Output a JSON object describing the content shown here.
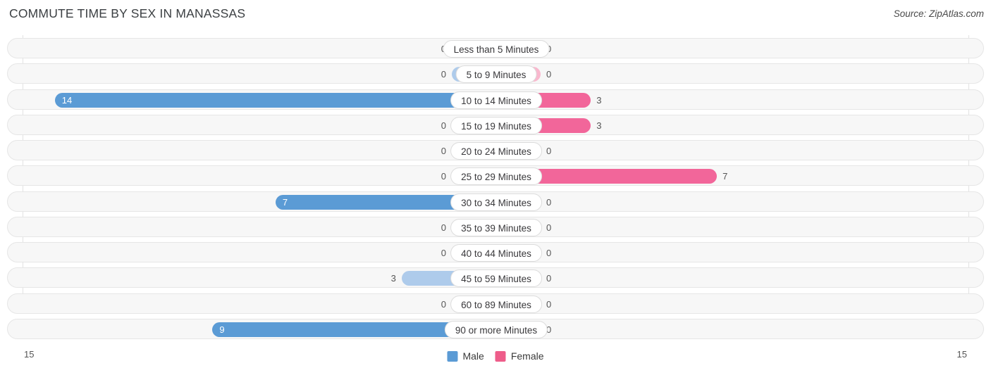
{
  "header": {
    "title": "COMMUTE TIME BY SEX IN MANASSAS",
    "source": "Source: ZipAtlas.com"
  },
  "axis": {
    "left_max_label": "15",
    "right_max_label": "15"
  },
  "legend": {
    "items": [
      {
        "label": "Male",
        "color": "#5B9BD5",
        "icon": "square-swatch-icon"
      },
      {
        "label": "Female",
        "color": "#EE5D8A",
        "icon": "square-swatch-icon"
      }
    ]
  },
  "colors": {
    "male_strong": "#5B9BD5",
    "male_light": "#AECBEB",
    "female_strong": "#F2669A",
    "female_light": "#F9B8CE",
    "row_track": "#f7f7f7",
    "row_border": "#e6e6e6",
    "gridline": "#e2e2e2"
  },
  "chart_data": {
    "type": "bar",
    "title": "COMMUTE TIME BY SEX IN MANASSAS",
    "subtitle": "",
    "xlabel": "",
    "ylabel": "",
    "orientation": "horizontal-diverging",
    "grid": true,
    "legend_position": "bottom-center",
    "axis_max": 15,
    "xlim": [
      15,
      15
    ],
    "categories": [
      "Less than 5 Minutes",
      "5 to 9 Minutes",
      "10 to 14 Minutes",
      "15 to 19 Minutes",
      "20 to 24 Minutes",
      "25 to 29 Minutes",
      "30 to 34 Minutes",
      "35 to 39 Minutes",
      "40 to 44 Minutes",
      "45 to 59 Minutes",
      "60 to 89 Minutes",
      "90 or more Minutes"
    ],
    "series": [
      {
        "name": "Male",
        "side": "left",
        "color": "#5B9BD5",
        "values": [
          0,
          0,
          14,
          0,
          0,
          0,
          7,
          0,
          0,
          3,
          0,
          9
        ],
        "labels": [
          "0",
          "0",
          "14",
          "0",
          "0",
          "0",
          "7",
          "0",
          "0",
          "3",
          "0",
          "9"
        ]
      },
      {
        "name": "Female",
        "side": "right",
        "color": "#EE5D8A",
        "values": [
          0,
          0,
          3,
          3,
          0,
          7,
          0,
          0,
          0,
          0,
          0,
          0
        ],
        "labels": [
          "0",
          "0",
          "3",
          "3",
          "0",
          "7",
          "0",
          "0",
          "0",
          "0",
          "0",
          "0"
        ]
      }
    ]
  }
}
